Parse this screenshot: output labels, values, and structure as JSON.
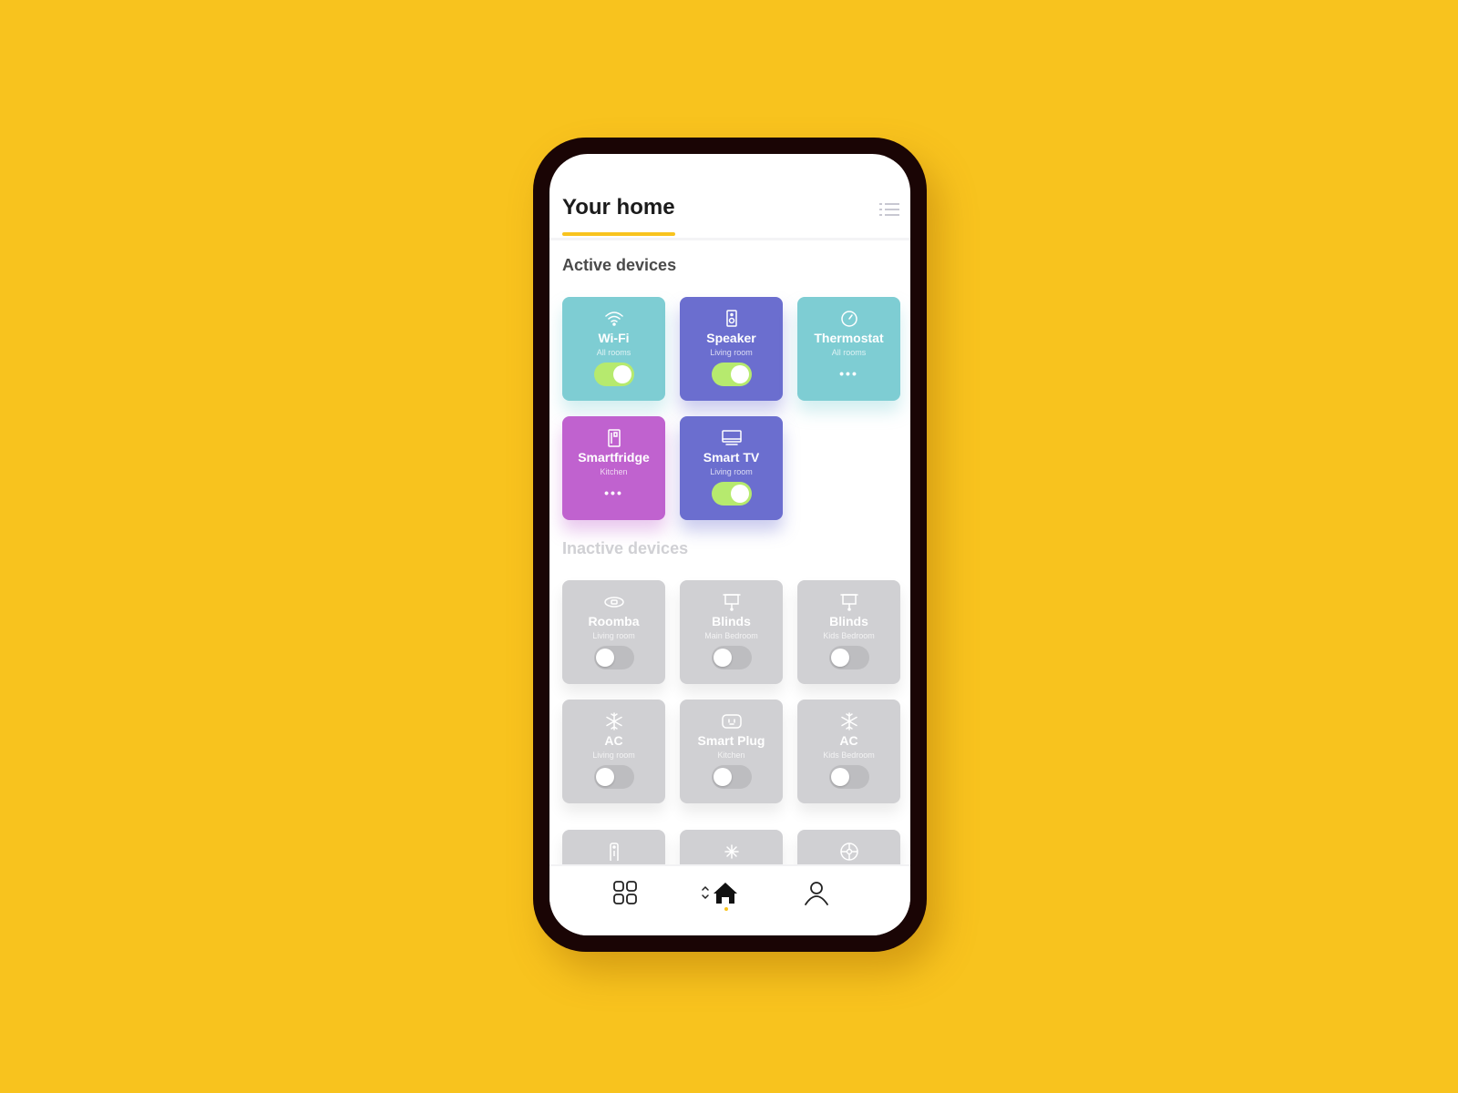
{
  "app": {
    "background_color": "#F8C31E",
    "accent_color": "#F8C31E"
  },
  "header": {
    "title": "Your home",
    "menu_icon": "list-icon"
  },
  "active_section": {
    "title": "Active devices",
    "devices": [
      {
        "name": "Wi-Fi",
        "room": "All rooms",
        "icon": "wifi-icon",
        "color": "#7ECDD3",
        "control": "toggle",
        "state": "on"
      },
      {
        "name": "Speaker",
        "room": "Living room",
        "icon": "speaker-icon",
        "color": "#6B6ECF",
        "control": "toggle",
        "state": "on"
      },
      {
        "name": "Thermostat",
        "room": "All rooms",
        "icon": "thermostat-icon",
        "color": "#7ECDD3",
        "control": "more",
        "more_label": "•••"
      },
      {
        "name": "Smartfridge",
        "room": "Kitchen",
        "icon": "fridge-icon",
        "color": "#C062CF",
        "control": "more",
        "more_label": "•••"
      },
      {
        "name": "Smart TV",
        "room": "Living room",
        "icon": "tv-icon",
        "color": "#6B6ECF",
        "control": "toggle",
        "state": "on"
      }
    ]
  },
  "inactive_section": {
    "title": "Inactive devices",
    "devices": [
      {
        "name": "Roomba",
        "room": "Living room",
        "icon": "roomba-icon",
        "state": "off"
      },
      {
        "name": "Blinds",
        "room": "Main Bedroom",
        "icon": "blinds-icon",
        "state": "off"
      },
      {
        "name": "Blinds",
        "room": "Kids Bedroom",
        "icon": "blinds-icon",
        "state": "off"
      },
      {
        "name": "AC",
        "room": "Living room",
        "icon": "snowflake-icon",
        "state": "off"
      },
      {
        "name": "Smart Plug",
        "room": "Kitchen",
        "icon": "plug-icon",
        "state": "off"
      },
      {
        "name": "AC",
        "room": "Kids Bedroom",
        "icon": "snowflake-icon",
        "state": "off"
      }
    ],
    "partial_devices": [
      {
        "icon": "remote-icon"
      },
      {
        "icon": "fan-icon"
      },
      {
        "icon": "wheel-icon"
      }
    ]
  },
  "bottom_nav": {
    "items": [
      {
        "name": "dashboard",
        "icon": "grid-icon"
      },
      {
        "name": "home",
        "icon": "home-icon",
        "active": true
      },
      {
        "name": "profile",
        "icon": "user-icon"
      }
    ]
  }
}
